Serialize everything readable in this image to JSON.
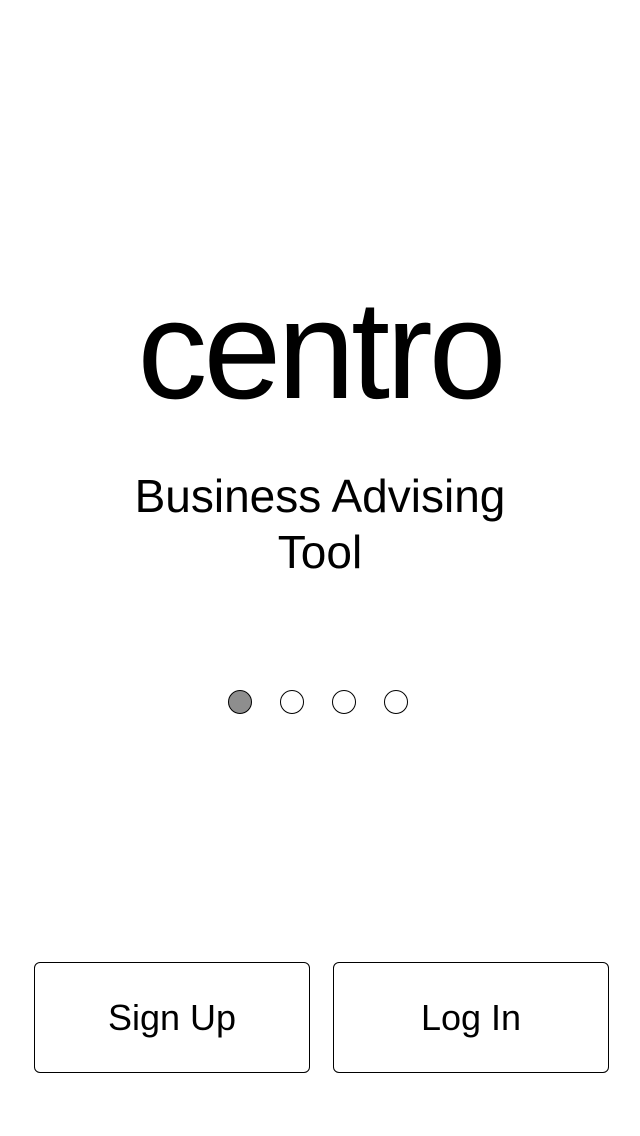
{
  "app": {
    "logo_text": "centro",
    "tagline": "Business Advising Tool"
  },
  "pager": {
    "total_pages": 4,
    "active_page": 1
  },
  "actions": {
    "signup_label": "Sign Up",
    "login_label": "Log In"
  },
  "colors": {
    "active_dot": "#8e8e8e",
    "background": "#ffffff",
    "text": "#000000"
  }
}
